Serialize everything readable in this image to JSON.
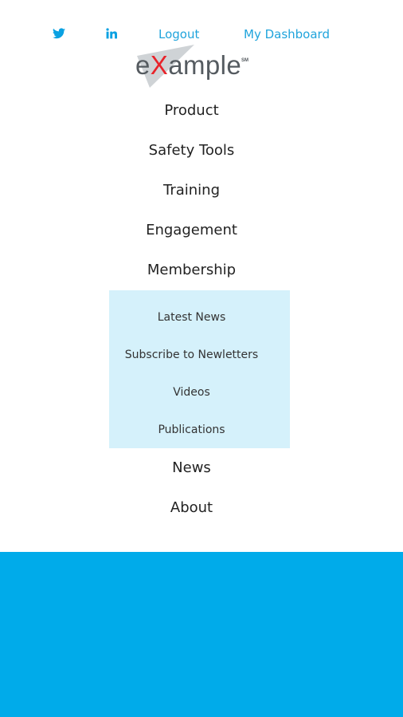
{
  "topbar": {
    "twitter_icon": "twitter-icon",
    "linkedin_icon": "linkedin-icon",
    "logout_label": "Logout",
    "dashboard_label": "My Dashboard",
    "link_color": "#20a4dc"
  },
  "logo": {
    "text_before": "e",
    "text_accent": "X",
    "text_after": "ample",
    "mark": "SM",
    "accent_color": "#e8232a"
  },
  "nav": {
    "items": [
      {
        "label": "Product"
      },
      {
        "label": "Safety Tools"
      },
      {
        "label": "Training"
      },
      {
        "label": "Engagement"
      },
      {
        "label": "Membership"
      },
      {
        "label": "News"
      },
      {
        "label": "About"
      }
    ],
    "submenu": {
      "background": "#d5f1fb",
      "items": [
        {
          "label": "Latest News"
        },
        {
          "label": "Subscribe to Newletters"
        },
        {
          "label": "Videos"
        },
        {
          "label": "Publications"
        }
      ]
    }
  },
  "footer": {
    "background": "#00abea"
  }
}
